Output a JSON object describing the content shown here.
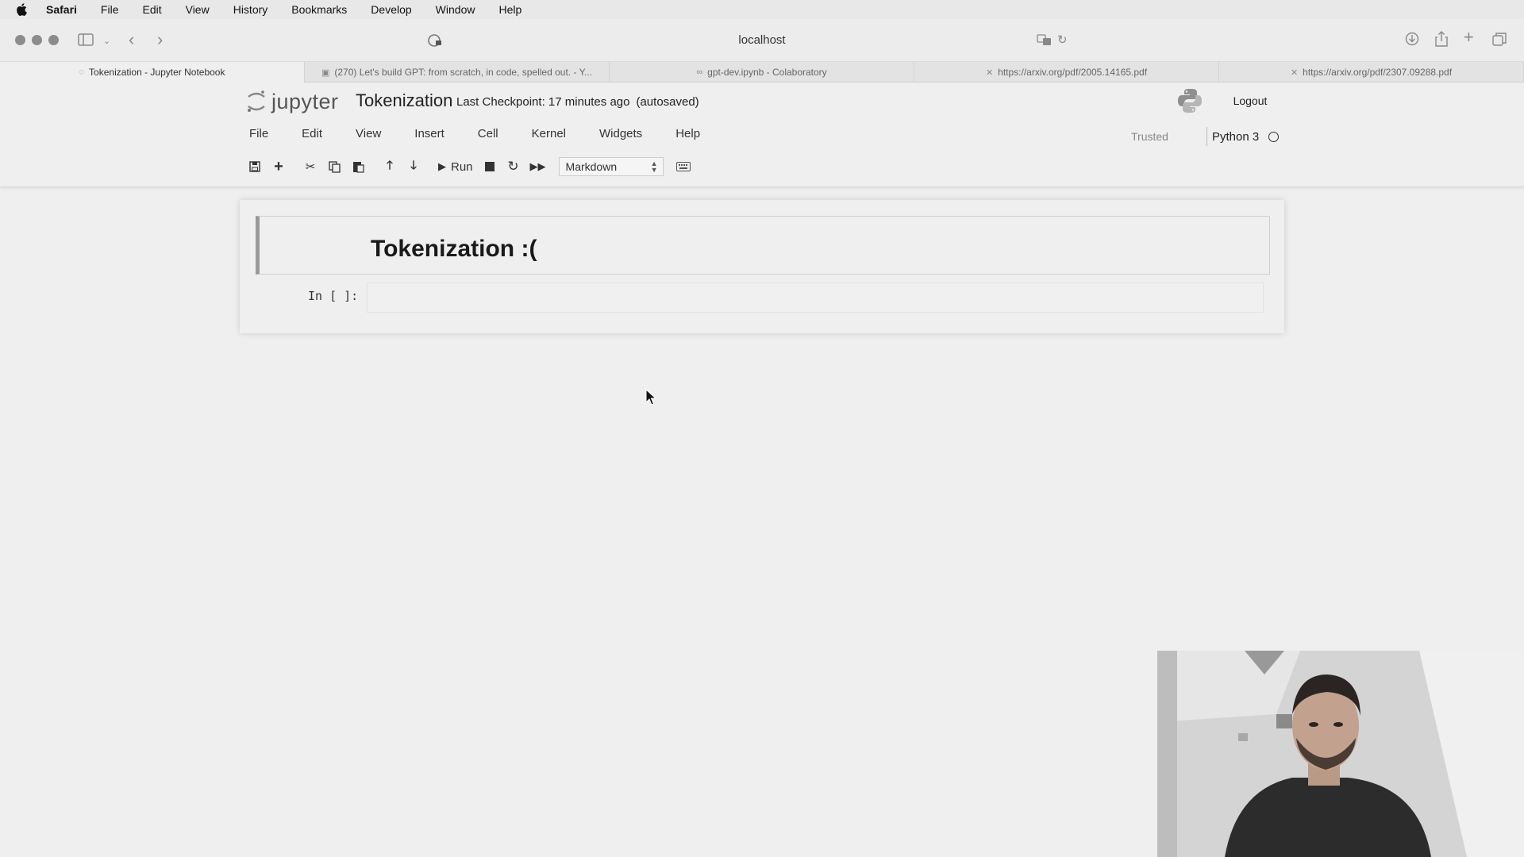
{
  "menubar": {
    "items": [
      {
        "label": "Safari",
        "bold": true
      },
      {
        "label": "File"
      },
      {
        "label": "Edit"
      },
      {
        "label": "View"
      },
      {
        "label": "History"
      },
      {
        "label": "Bookmarks"
      },
      {
        "label": "Develop"
      },
      {
        "label": "Window"
      },
      {
        "label": "Help"
      }
    ]
  },
  "browser": {
    "address": "localhost",
    "tabs": [
      {
        "label": "Tokenization - Jupyter Notebook",
        "icon": "loading-icon",
        "active": true
      },
      {
        "label": "(270) Let's build GPT: from scratch, in code, spelled out. - Y...",
        "icon": "youtube-icon"
      },
      {
        "label": "gpt-dev.ipynb - Colaboratory",
        "icon": "colab-icon"
      },
      {
        "label": "https://arxiv.org/pdf/2005.14165.pdf",
        "icon": "arxiv-icon"
      },
      {
        "label": "https://arxiv.org/pdf/2307.09288.pdf",
        "icon": "arxiv-icon"
      }
    ]
  },
  "jupyter": {
    "logo_text": "jupyter",
    "notebook_title": "Tokenization",
    "checkpoint": "Last Checkpoint: 17 minutes ago",
    "autosaved": "(autosaved)",
    "logout": "Logout",
    "menu": [
      "File",
      "Edit",
      "View",
      "Insert",
      "Cell",
      "Kernel",
      "Widgets",
      "Help"
    ],
    "trusted": "Trusted",
    "kernel_name": "Python 3",
    "toolbar": {
      "run_label": "Run",
      "cell_type": "Markdown"
    }
  },
  "notebook": {
    "markdown_heading": "Tokenization :(",
    "code_prompt": "In [ ]:"
  }
}
